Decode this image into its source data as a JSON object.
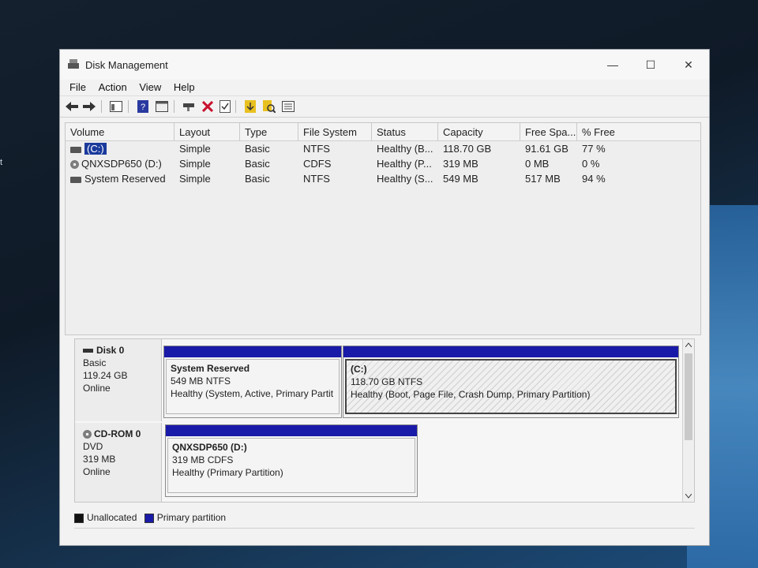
{
  "window": {
    "title": "Disk Management"
  },
  "desktop_text": "t",
  "menu": [
    "File",
    "Action",
    "View",
    "Help"
  ],
  "toolbar": [
    "back-icon",
    "forward-icon",
    "properties-icon",
    "help-icon",
    "console-icon",
    "connect-icon",
    "delete-icon",
    "check-icon",
    "import-icon",
    "search-icon",
    "list-icon"
  ],
  "volumes": {
    "columns": [
      "Volume",
      "Layout",
      "Type",
      "File System",
      "Status",
      "Capacity",
      "Free Spa...",
      "% Free"
    ],
    "rows": [
      {
        "volume": "(C:)",
        "layout": "Simple",
        "type": "Basic",
        "fs": "NTFS",
        "status": "Healthy (B...",
        "capacity": "118.70 GB",
        "free": "91.61 GB",
        "pct": "77 %",
        "icon": "drive-icon",
        "selected": true
      },
      {
        "volume": "QNXSDP650 (D:)",
        "layout": "Simple",
        "type": "Basic",
        "fs": "CDFS",
        "status": "Healthy (P...",
        "capacity": "319 MB",
        "free": "0 MB",
        "pct": "0 %",
        "icon": "cd-icon",
        "selected": false
      },
      {
        "volume": "System Reserved",
        "layout": "Simple",
        "type": "Basic",
        "fs": "NTFS",
        "status": "Healthy (S...",
        "capacity": "549 MB",
        "free": "517 MB",
        "pct": "94 %",
        "icon": "drive-icon",
        "selected": false
      }
    ]
  },
  "disks": [
    {
      "name": "Disk 0",
      "kind": "Basic",
      "size": "119.24 GB",
      "state": "Online",
      "partitions": [
        {
          "name": "System Reserved",
          "detail": "549 MB NTFS",
          "status": "Healthy (System, Active, Primary Partit"
        },
        {
          "name": "(C:)",
          "detail": "118.70 GB NTFS",
          "status": "Healthy (Boot, Page File, Crash Dump, Primary Partition)"
        }
      ]
    },
    {
      "name": "CD-ROM 0",
      "kind": "DVD",
      "size": "319 MB",
      "state": "Online",
      "partitions": [
        {
          "name": "QNXSDP650  (D:)",
          "detail": "319 MB CDFS",
          "status": "Healthy (Primary Partition)"
        }
      ]
    }
  ],
  "legend": [
    {
      "label": "Unallocated",
      "color": "#111111"
    },
    {
      "label": "Primary partition",
      "color": "#1a1aa8"
    }
  ]
}
